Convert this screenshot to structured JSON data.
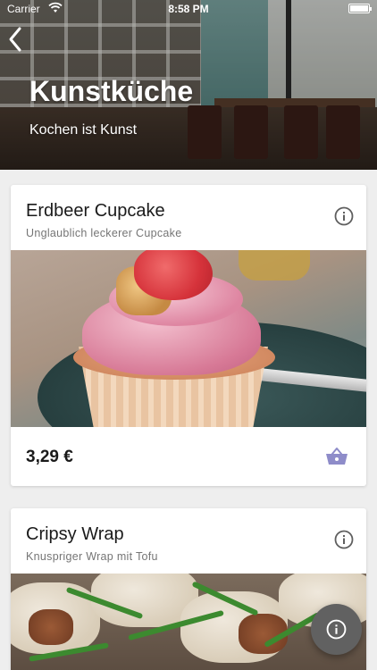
{
  "status_bar": {
    "carrier": "Carrier",
    "time": "8:58 PM"
  },
  "header": {
    "title": "Kunstküche",
    "subtitle": "Kochen ist Kunst"
  },
  "products": [
    {
      "name": "Erdbeer Cupcake",
      "description": "Unglaublich leckerer Cupcake",
      "price": "3,29 €"
    },
    {
      "name": "Cripsy Wrap",
      "description": "Knuspriger Wrap mit Tofu"
    }
  ],
  "icons": {
    "back": "chevron-left-icon",
    "info": "info-icon",
    "basket": "basket-icon"
  },
  "colors": {
    "basket": "#8e8cc9",
    "fab": "#616161"
  }
}
